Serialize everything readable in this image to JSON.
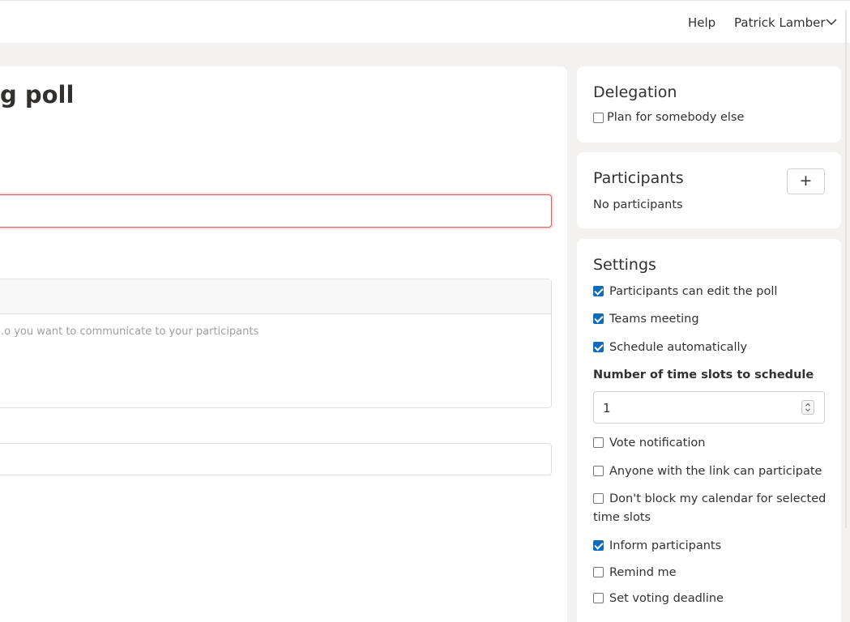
{
  "header": {
    "help_label": "Help",
    "user_name": "Patrick Lamber"
  },
  "main": {
    "title": "g poll",
    "description_placeholder": "o you want to communicate to your participants."
  },
  "delegation": {
    "title": "Delegation",
    "plan_for_other_label": "Plan for somebody else",
    "plan_for_other_checked": false
  },
  "participants": {
    "title": "Participants",
    "add_label": "+",
    "empty_text": "No participants"
  },
  "settings": {
    "title": "Settings",
    "options": [
      {
        "label": "Participants can edit the poll",
        "checked": true
      },
      {
        "label": "Teams meeting",
        "checked": true
      },
      {
        "label": "Schedule automatically",
        "checked": true
      }
    ],
    "slots_label": "Number of time slots to schedule",
    "slots_value": "1",
    "more_options": [
      {
        "label": "Vote notification",
        "checked": false
      },
      {
        "label": "Anyone with the link can participate",
        "checked": false
      },
      {
        "label": "Don't block my calendar for selected time slots",
        "checked": false
      },
      {
        "label": "Inform participants",
        "checked": true
      },
      {
        "label": "Remind me",
        "checked": false
      },
      {
        "label": "Set voting deadline",
        "checked": false
      }
    ]
  },
  "colors": {
    "accent": "#0f6cbd",
    "error_border": "#d85f5f",
    "page_bg": "#f3f2f1"
  }
}
